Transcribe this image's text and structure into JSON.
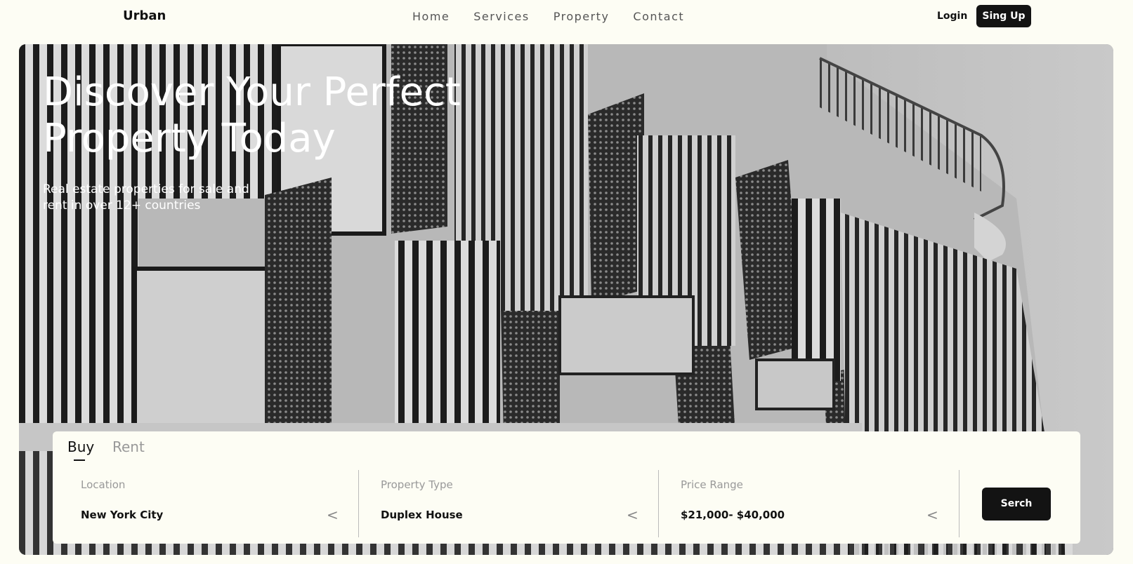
{
  "nav": {
    "brand": "Urban",
    "links": [
      "Home",
      "Services",
      "Property",
      "Contact"
    ],
    "login": "Login",
    "signup": "Sing Up"
  },
  "hero": {
    "title_line1": "Discover Your Perfect",
    "title_line2": "Property Today",
    "subtitle_line1": "Real estate properties for sale and",
    "subtitle_line2": "rent in over 12+ countries"
  },
  "search": {
    "tabs": [
      "Buy",
      "Rent"
    ],
    "active_tab": "Buy",
    "fields": [
      {
        "label": "Location",
        "value": "New York City"
      },
      {
        "label": "Property Type",
        "value": "Duplex House"
      },
      {
        "label": "Price Range",
        "value": "$21,000- $40,000"
      }
    ],
    "chevron_glyph": "<",
    "button": "Serch"
  },
  "colors": {
    "background": "#fdfdf4",
    "button": "#131313"
  }
}
